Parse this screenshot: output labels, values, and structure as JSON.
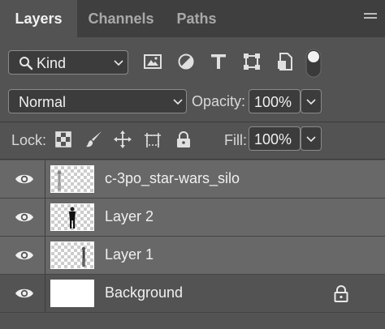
{
  "tabs": [
    {
      "label": "Layers",
      "active": true
    },
    {
      "label": "Channels",
      "active": false
    },
    {
      "label": "Paths",
      "active": false
    }
  ],
  "filter": {
    "kind_label": "Kind",
    "icons": [
      "image-filter-icon",
      "adjustment-filter-icon",
      "type-filter-icon",
      "shape-filter-icon",
      "smart-object-filter-icon",
      "filter-toggle-icon"
    ]
  },
  "blend": {
    "mode": "Normal",
    "opacity_label": "Opacity:",
    "opacity_value": "100%"
  },
  "lock": {
    "label": "Lock:",
    "icons": [
      "lock-transparent-pixels-icon",
      "lock-image-pixels-icon",
      "lock-position-icon",
      "lock-artboard-icon",
      "lock-all-icon"
    ],
    "fill_label": "Fill:",
    "fill_value": "100%"
  },
  "layers": [
    {
      "name": "c-3po_star-wars_silo",
      "visible": true,
      "selected": true,
      "thumbnail": "transparent",
      "locked": false
    },
    {
      "name": "Layer 2",
      "visible": true,
      "selected": true,
      "thumbnail": "transparent",
      "locked": false
    },
    {
      "name": "Layer 1",
      "visible": true,
      "selected": true,
      "thumbnail": "transparent",
      "locked": false
    },
    {
      "name": "Background",
      "visible": true,
      "selected": false,
      "thumbnail": "white",
      "locked": true
    }
  ],
  "colors": {
    "panel_bg": "#535353",
    "tab_bar_bg": "#3f3f3f",
    "selected_row": "#686868",
    "field_bg": "#3c3c3c"
  }
}
